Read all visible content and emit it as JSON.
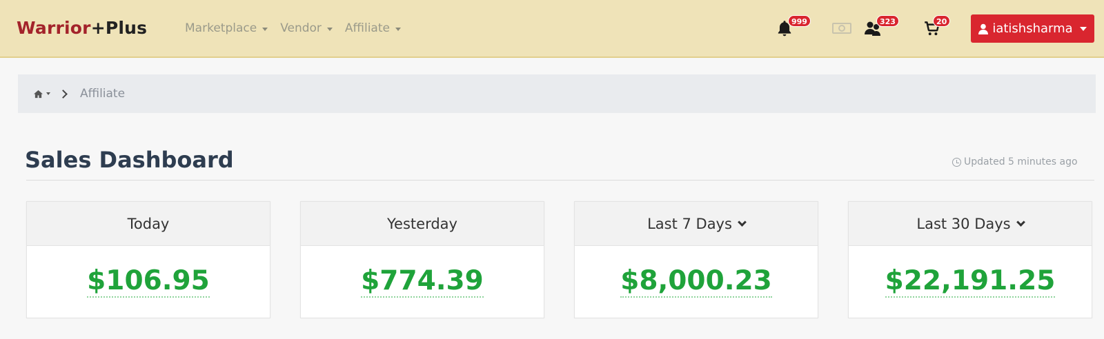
{
  "brand": {
    "part1": "Warrior",
    "part2": "+Plus"
  },
  "nav": {
    "items": [
      {
        "label": "Marketplace"
      },
      {
        "label": "Vendor"
      },
      {
        "label": "Affiliate"
      }
    ],
    "icons": [
      {
        "name": "bell-icon",
        "badge": "999"
      },
      {
        "name": "money-icon",
        "badge": ""
      },
      {
        "name": "users-icon",
        "badge": "323"
      },
      {
        "name": "cart-icon",
        "badge": "20"
      }
    ],
    "user": {
      "label": "iatishsharma",
      "icon": "user-icon"
    }
  },
  "breadcrumb": {
    "home_icon": "home-icon",
    "current": "Affiliate"
  },
  "header": {
    "title": "Sales Dashboard",
    "updated": "Updated 5 minutes ago"
  },
  "cards": [
    {
      "label": "Today",
      "value": "$106.95",
      "dropdown": false
    },
    {
      "label": "Yesterday",
      "value": "$774.39",
      "dropdown": false
    },
    {
      "label": "Last 7 Days",
      "value": "$8,000.23",
      "dropdown": true
    },
    {
      "label": "Last 30 Days",
      "value": "$22,191.25",
      "dropdown": true
    }
  ],
  "colors": {
    "navbar_bg": "#efe3b8",
    "brand_red": "#a3232b",
    "accent_red": "#d9262f",
    "amount_green": "#1fa33a"
  }
}
